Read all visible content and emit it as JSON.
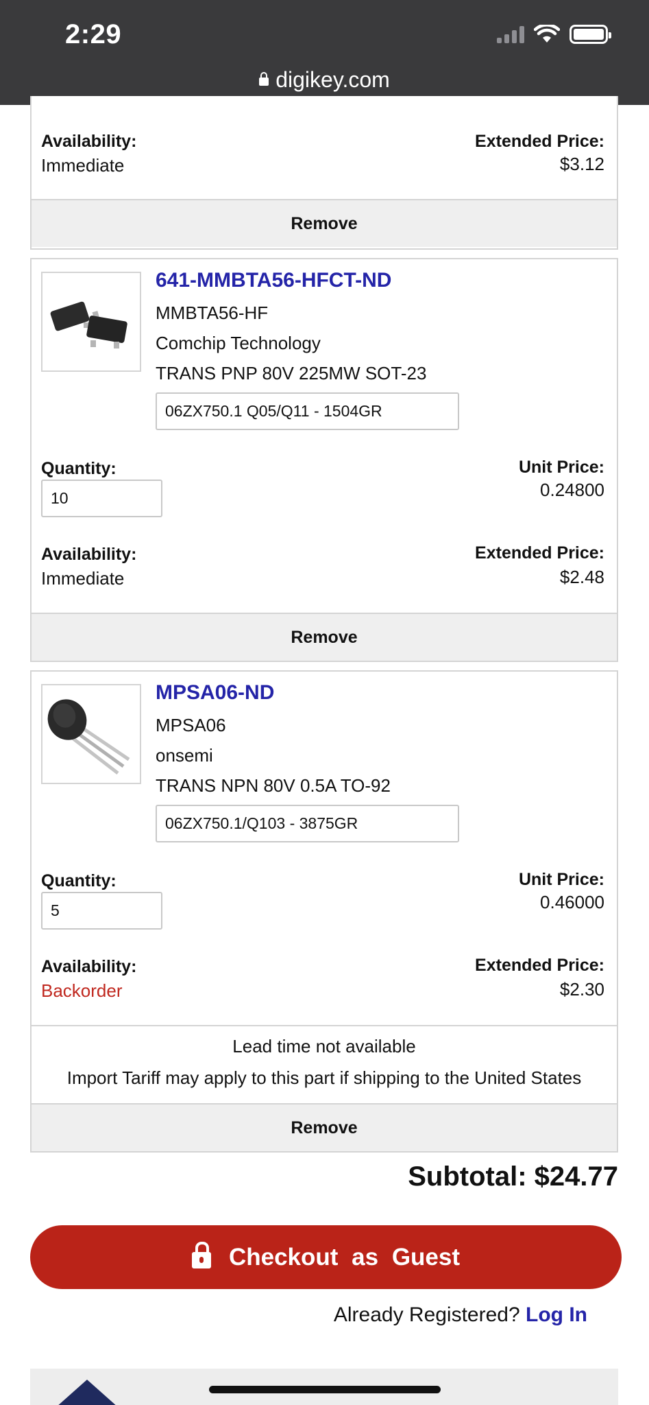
{
  "status_bar": {
    "time": "2:29"
  },
  "browser": {
    "url": "digikey.com"
  },
  "items": [
    {
      "availability_label": "Availability:",
      "availability": "Immediate",
      "extended_price_label": "Extended Price:",
      "extended_price": "$3.12",
      "remove_label": "Remove"
    },
    {
      "part_number": "641-MMBTA56-HFCT-ND",
      "mfr_part": "MMBTA56-HF",
      "manufacturer": "Comchip Technology",
      "description": "TRANS PNP 80V 225MW SOT-23",
      "customer_ref": "06ZX750.1 Q05/Q11 - 1504GR",
      "quantity_label": "Quantity:",
      "quantity": "10",
      "unit_price_label": "Unit Price:",
      "unit_price": "0.24800",
      "availability_label": "Availability:",
      "availability": "Immediate",
      "extended_price_label": "Extended Price:",
      "extended_price": "$2.48",
      "remove_label": "Remove",
      "thumbnail_icon": "sot23-package-icon"
    },
    {
      "part_number": "MPSA06-ND",
      "mfr_part": "MPSA06",
      "manufacturer": "onsemi",
      "description": "TRANS NPN 80V 0.5A TO-92",
      "customer_ref": "06ZX750.1/Q103 - 3875GR",
      "quantity_label": "Quantity:",
      "quantity": "5",
      "unit_price_label": "Unit Price:",
      "unit_price": "0.46000",
      "availability_label": "Availability:",
      "availability": "Backorder",
      "extended_price_label": "Extended Price:",
      "extended_price": "$2.30",
      "lead_time": "Lead time not available",
      "tariff_notice": "Import Tariff may apply to this part if shipping to the United States",
      "remove_label": "Remove",
      "thumbnail_icon": "to92-package-icon"
    }
  ],
  "cart": {
    "subtotal_label": "Subtotal:",
    "subtotal": "$24.77",
    "checkout_label": "Checkout as Guest",
    "registered_prompt": "Already Registered?",
    "login_label": "Log In"
  },
  "colors": {
    "link_blue": "#2424a8",
    "checkout_red": "#ba2318",
    "backorder_red": "#c0281f",
    "status_bar": "#3a3a3c"
  }
}
